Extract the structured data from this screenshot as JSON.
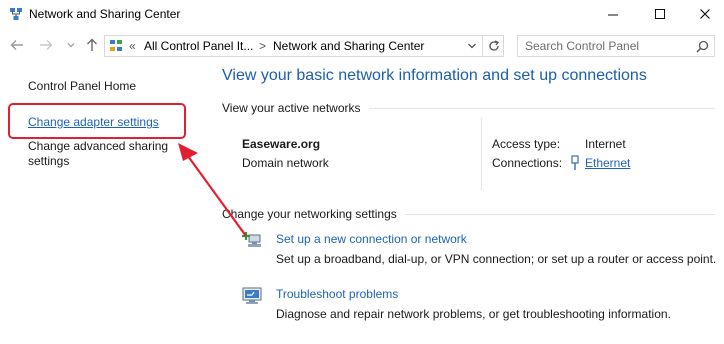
{
  "window": {
    "title": "Network and Sharing Center",
    "minimize_glyph": "—",
    "maximize_glyph": "☐",
    "close_glyph": "✕"
  },
  "address_bar": {
    "overflow": "«",
    "crumbs": [
      "All Control Panel It...",
      "Network and Sharing Center"
    ],
    "separator": ">"
  },
  "search": {
    "placeholder": "Search Control Panel"
  },
  "left_pane": {
    "home": "Control Panel Home",
    "adapter": "Change adapter settings",
    "advanced_line1": "Change advanced sharing",
    "advanced_line2": "settings"
  },
  "main": {
    "heading": "View your basic network information and set up connections",
    "active_networks_label": "View your active networks",
    "network": {
      "name": "Easeware.org",
      "type": "Domain network",
      "access_type_label": "Access type:",
      "access_type_value": "Internet",
      "connections_label": "Connections:",
      "connections_value": "Ethernet"
    },
    "change_settings_label": "Change your networking settings",
    "tasks": [
      {
        "icon": "new-connection-icon",
        "title": "Set up a new connection or network",
        "description": "Set up a broadband, dial-up, or VPN connection; or set up a router or access point."
      },
      {
        "icon": "troubleshoot-icon",
        "title": "Troubleshoot problems",
        "description": "Diagnose and repair network problems, or get troubleshooting information."
      }
    ]
  },
  "colors": {
    "link": "#1d63b8",
    "heading": "#1a5fa8",
    "annotation": "#e02030"
  }
}
